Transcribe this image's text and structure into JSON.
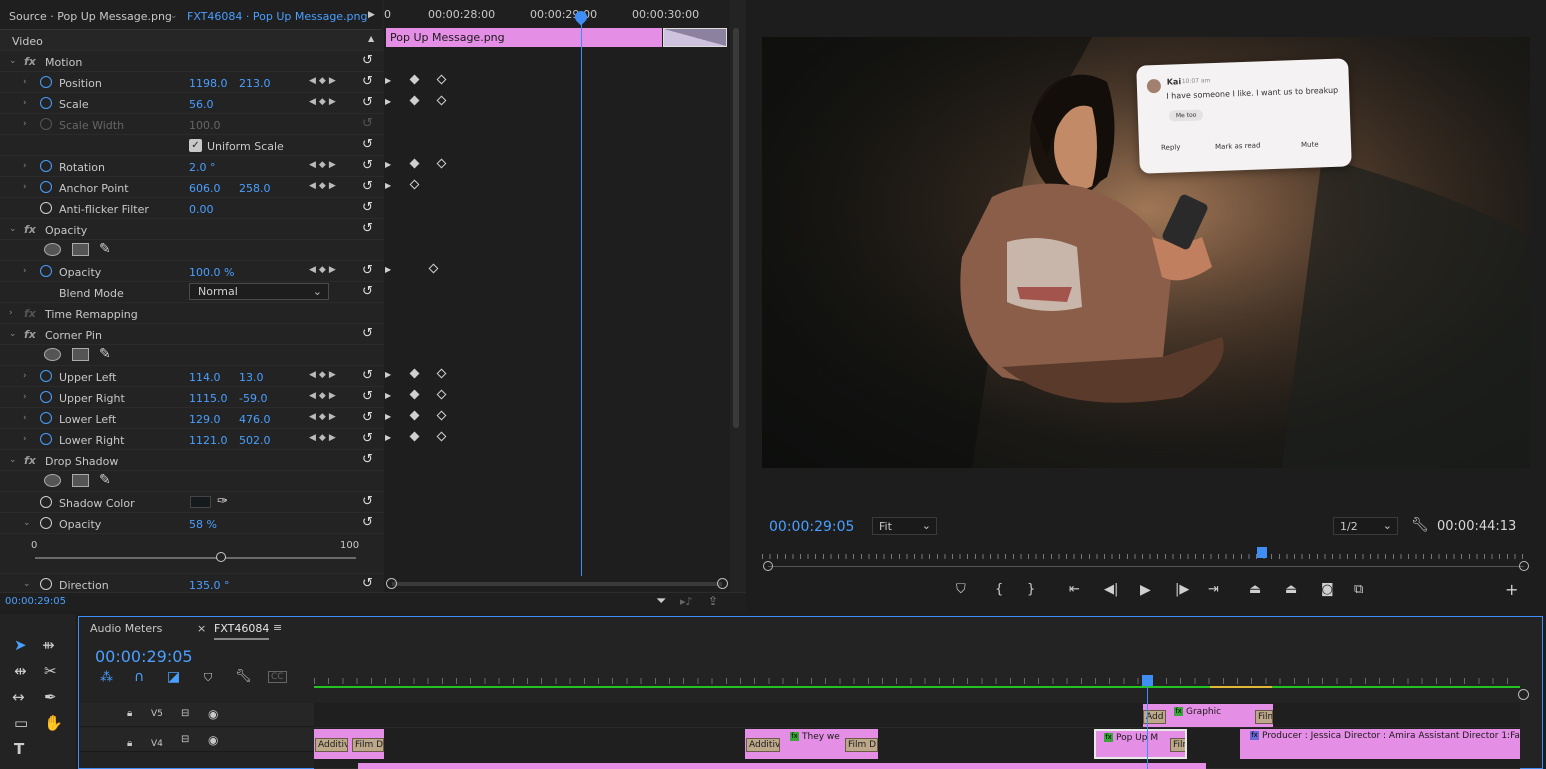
{
  "effect_controls": {
    "tab_source": "Source · Pop Up Message.png",
    "tab_sequence": "FXT46084 · Pop Up Message.png",
    "section_video": "Video",
    "ruler_ticks": [
      "0",
      "00:00:28:00",
      "00:00:29:00",
      "00:00:30:00"
    ],
    "clip_name": "Pop Up Message.png",
    "motion": "Motion",
    "position": {
      "label": "Position",
      "x": "1198.0",
      "y": "213.0"
    },
    "scale": {
      "label": "Scale",
      "value": "56.0"
    },
    "scale_width": {
      "label": "Scale Width",
      "value": "100.0"
    },
    "uniform_scale": "Uniform Scale",
    "rotation": {
      "label": "Rotation",
      "value": "2.0 °"
    },
    "anchor": {
      "label": "Anchor Point",
      "x": "606.0",
      "y": "258.0"
    },
    "antiflicker": {
      "label": "Anti-flicker Filter",
      "value": "0.00"
    },
    "opacity_section": "Opacity",
    "opacity": {
      "label": "Opacity",
      "value": "100.0 %"
    },
    "blend_mode": {
      "label": "Blend Mode",
      "value": "Normal"
    },
    "time_remapping": "Time Remapping",
    "corner_pin": "Corner Pin",
    "upper_left": {
      "label": "Upper Left",
      "x": "114.0",
      "y": "13.0"
    },
    "upper_right": {
      "label": "Upper Right",
      "x": "1115.0",
      "y": "-59.0"
    },
    "lower_left": {
      "label": "Lower Left",
      "x": "129.0",
      "y": "476.0"
    },
    "lower_right": {
      "label": "Lower Right",
      "x": "1121.0",
      "y": "502.0"
    },
    "drop_shadow": "Drop Shadow",
    "shadow_color": {
      "label": "Shadow Color"
    },
    "ds_opacity": {
      "label": "Opacity",
      "value": "58 %"
    },
    "slider_min": "0",
    "slider_max": "100",
    "slider_value_fraction": 0.58,
    "direction": {
      "label": "Direction",
      "value": "135.0 °"
    },
    "timecode": "00:00:29:05"
  },
  "program_monitor": {
    "timecode": "00:00:29:05",
    "fit": "Fit",
    "resolution": "1/2",
    "duration": "00:00:44:13",
    "popup": {
      "sender": "Kai",
      "time": "10:07 am",
      "message": "I have someone I like. I want us to breakup",
      "quick_reply": "Me too",
      "actions": [
        "Reply",
        "Mark as read",
        "Mute"
      ]
    }
  },
  "timeline": {
    "tab_audio": "Audio Meters",
    "tab_sequence": "FXT46084",
    "timecode": "00:00:29:05",
    "tracks": [
      {
        "name": "V5"
      },
      {
        "name": "V4"
      }
    ],
    "clips": {
      "graphic": "Graphic",
      "add": "Add",
      "film1": "Film",
      "additive1": "Additiv",
      "filmdi1": "Film Di",
      "additive2": "Additiv",
      "theywe": "They we",
      "filmdi2": "Film Di",
      "popupm": "Pop Up M",
      "film2": "Film",
      "producer": "Producer : Jessica Director : Amira Assistant Director 1:Fariha"
    }
  }
}
